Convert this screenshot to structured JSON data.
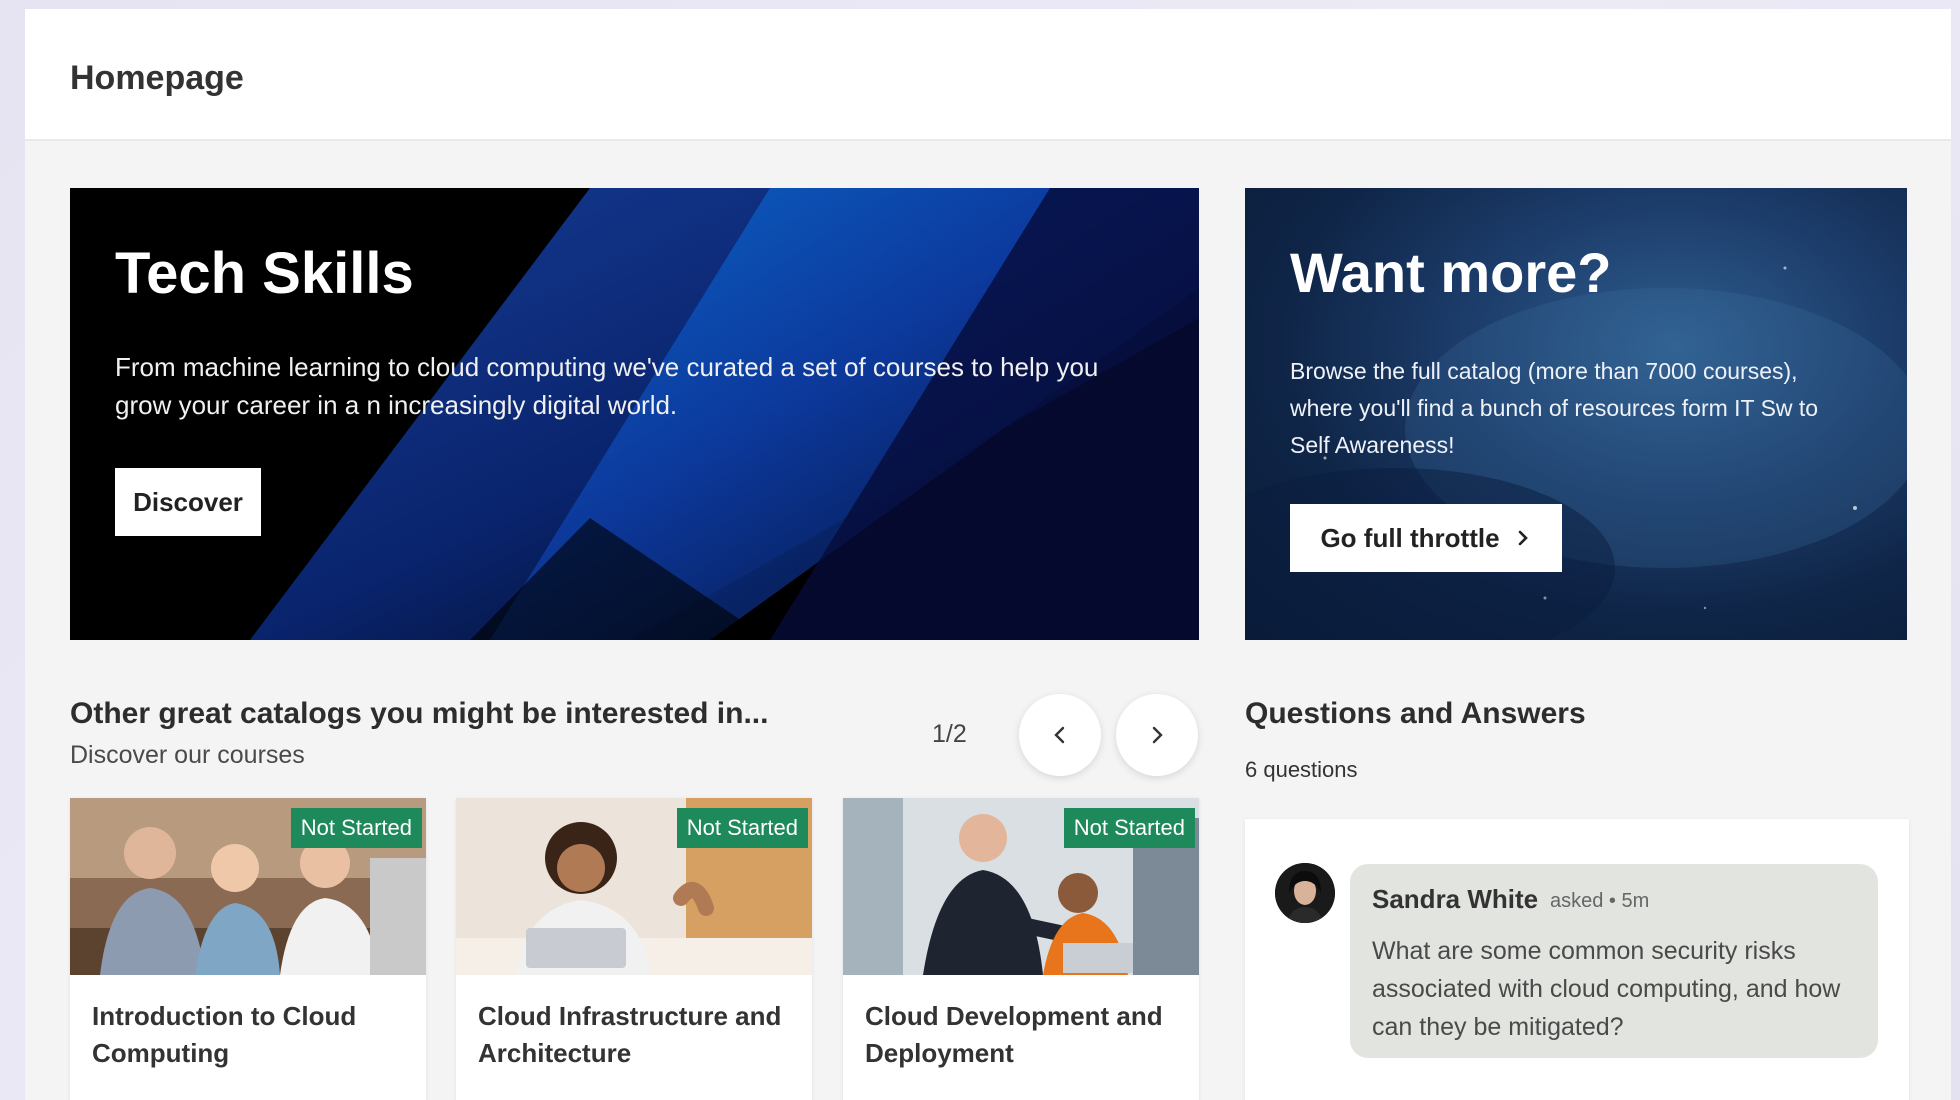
{
  "header": {
    "title": "Homepage"
  },
  "hero": {
    "title": "Tech Skills",
    "description": "From machine learning to cloud computing we've curated a set of courses to help you grow your career in a n increasingly digital world.",
    "button_label": "Discover"
  },
  "promo": {
    "title": "Want more?",
    "description": "Browse the full catalog (more than 7000 courses), where you'll find a bunch of resources form IT Sw to Self Awareness!",
    "button_label": "Go full throttle"
  },
  "catalogs": {
    "title": "Other great catalogs you might be interested in...",
    "subtitle": "Discover our courses",
    "pager": "1/2",
    "cards": [
      {
        "title": "Introduction to Cloud Computing",
        "status": "Not Started"
      },
      {
        "title": "Cloud Infrastructure and Architecture",
        "status": "Not Started"
      },
      {
        "title": "Cloud Development and Deployment",
        "status": "Not Started"
      }
    ]
  },
  "qa": {
    "title": "Questions and Answers",
    "count": "6 questions",
    "items": [
      {
        "author": "Sandra White",
        "meta": "asked • 5m",
        "question": "What are some common security risks associated with cloud computing, and how can they be mitigated?"
      }
    ]
  },
  "colors": {
    "badge": "#1e8a5c",
    "hero_bg": "#000000",
    "promo_bg": "#1c3c6a",
    "page_bg": "#f4f4f4"
  }
}
